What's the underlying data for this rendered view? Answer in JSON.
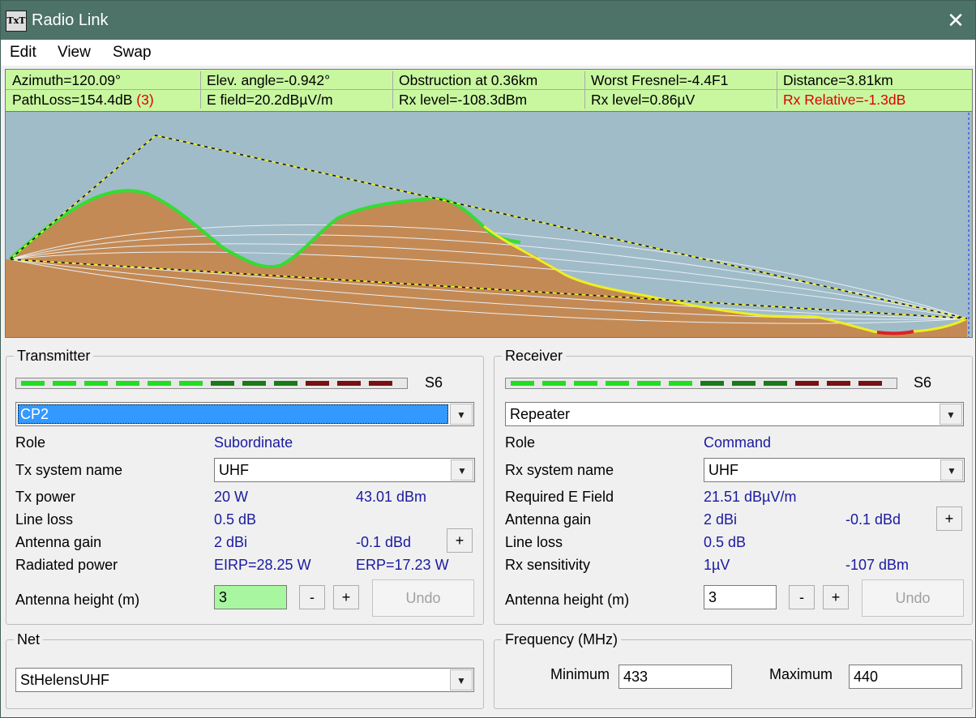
{
  "window": {
    "title": "Radio Link",
    "close_glyph": "✕",
    "app_icon_text": "TxT"
  },
  "menu": [
    "Edit",
    "View",
    "Swap"
  ],
  "info": {
    "row1": [
      "Azimuth=120.09°",
      "Elev. angle=-0.942°",
      "Obstruction at 0.36km",
      "Worst Fresnel=-4.4F1",
      "Distance=3.81km"
    ],
    "row2": {
      "pathloss": "PathLoss=154.4dB",
      "pathloss_note": "(3)",
      "efield": "E field=20.2dBµV/m",
      "rx_level_dbm": "Rx level=-108.3dBm",
      "rx_level_uv": "Rx level=0.86µV",
      "rx_relative": "Rx Relative=-1.3dB"
    },
    "colors": {
      "bg": "#c8f7a0",
      "alert": "#e00000"
    }
  },
  "transmitter": {
    "group_label": "Transmitter",
    "meter_label": "S6",
    "unit": "CP2",
    "role_label": "Role",
    "role_value": "Subordinate",
    "system_label": "Tx system name",
    "system_value": "UHF",
    "power_label": "Tx power",
    "power_w": "20 W",
    "power_dbm": "43.01 dBm",
    "line_loss_label": "Line loss",
    "line_loss": "0.5 dB",
    "gain_label": "Antenna gain",
    "gain_dbi": "2 dBi",
    "gain_dbd": "-0.1 dBd",
    "radiated_label": "Radiated power",
    "eirp": "EIRP=28.25 W",
    "erp": "ERP=17.23 W",
    "height_label": "Antenna height (m)",
    "height_value": "3",
    "plus": "+",
    "minus": "-",
    "undo": "Undo"
  },
  "receiver": {
    "group_label": "Receiver",
    "meter_label": "S6",
    "unit": "Repeater",
    "role_label": "Role",
    "role_value": "Command",
    "system_label": "Rx system name",
    "system_value": "UHF",
    "efield_label": "Required E Field",
    "efield_value": "21.51 dBµV/m",
    "gain_label": "Antenna gain",
    "gain_dbi": "2 dBi",
    "gain_dbd": "-0.1 dBd",
    "line_loss_label": "Line loss",
    "line_loss": "0.5 dB",
    "sens_label": "Rx sensitivity",
    "sens_uv": "1µV",
    "sens_dbm": "-107 dBm",
    "height_label": "Antenna height (m)",
    "height_value": "3",
    "plus": "+",
    "minus": "-",
    "undo": "Undo"
  },
  "net": {
    "group_label": "Net",
    "value": "StHelensUHF"
  },
  "frequency": {
    "group_label": "Frequency (MHz)",
    "min_label": "Minimum",
    "min_value": "433",
    "max_label": "Maximum",
    "max_value": "440"
  },
  "meter_segments": [
    "#22dd22",
    "#22dd22",
    "#22dd22",
    "#22dd22",
    "#22dd22",
    "#22dd22",
    "#1a7a1a",
    "#1a7a1a",
    "#1a7a1a",
    "#7a1010",
    "#7a1010",
    "#7a1010"
  ],
  "profile_colors": {
    "sky": "#a0bcc8",
    "terrain": "#c48a55",
    "los_green": "#33dd33",
    "los_yellow": "#eeee22",
    "obstruction": "#dd2222"
  }
}
